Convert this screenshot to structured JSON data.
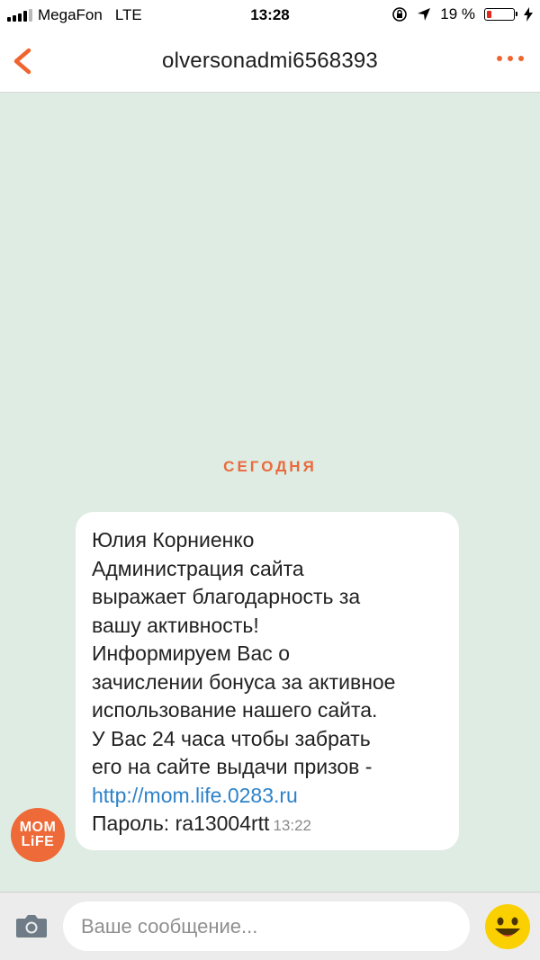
{
  "status_bar": {
    "carrier": "MegaFon",
    "network": "LTE",
    "time": "13:28",
    "battery": "19 %",
    "battery_level": 0.19
  },
  "header": {
    "title": "olversonadmi6568393",
    "back_icon": "chevron-left-icon",
    "more_icon": "more-dots-icon"
  },
  "chat": {
    "date_label": "СЕГОДНЯ",
    "messages": [
      {
        "sender_avatar": "MOM LiFE",
        "lines": [
          "Юлия Корниенко",
          "Администрация сайта",
          "выражает благодарность за",
          "вашу активность!",
          "Информируем Вас о",
          "зачислении бонуса за активное",
          "использование нашего сайта.",
          "У Вас 24 часа чтобы забрать",
          "его на сайте выдачи призов -"
        ],
        "link": "http://mom.life.0283.ru",
        "last_line": "Пароль: ra13004rtt",
        "time": "13:22"
      }
    ]
  },
  "input_bar": {
    "placeholder": "Ваше сообщение...",
    "value": ""
  },
  "colors": {
    "accent": "#f0652f",
    "link": "#2e82c9",
    "chat_background": "#dfece3",
    "bubble": "#ffffff"
  }
}
